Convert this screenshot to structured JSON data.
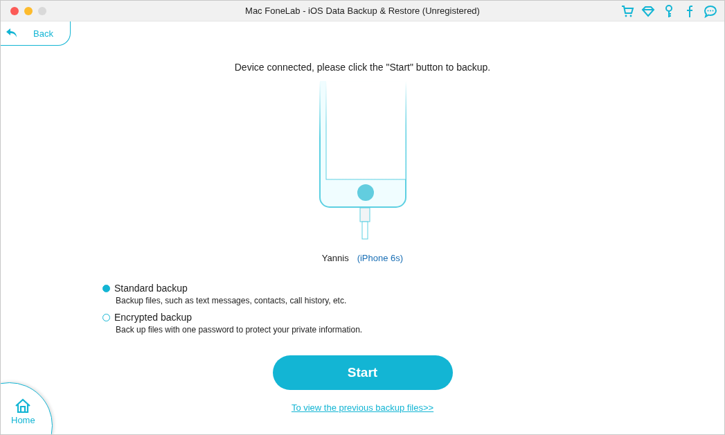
{
  "window": {
    "title": "Mac FoneLab - iOS Data Backup & Restore (Unregistered)"
  },
  "back": {
    "label": "Back"
  },
  "message": "Device connected, please click the \"Start\" button to backup.",
  "device": {
    "name": "Yannis",
    "model": "(iPhone 6s)"
  },
  "options": [
    {
      "label": "Standard backup",
      "description": "Backup files, such as text messages, contacts, call history, etc.",
      "selected": true
    },
    {
      "label": "Encrypted backup",
      "description": "Back up files with one password to protect your private information.",
      "selected": false
    }
  ],
  "start_button": "Start",
  "previous_link": "To view the previous backup files>>",
  "home": {
    "label": "Home"
  }
}
